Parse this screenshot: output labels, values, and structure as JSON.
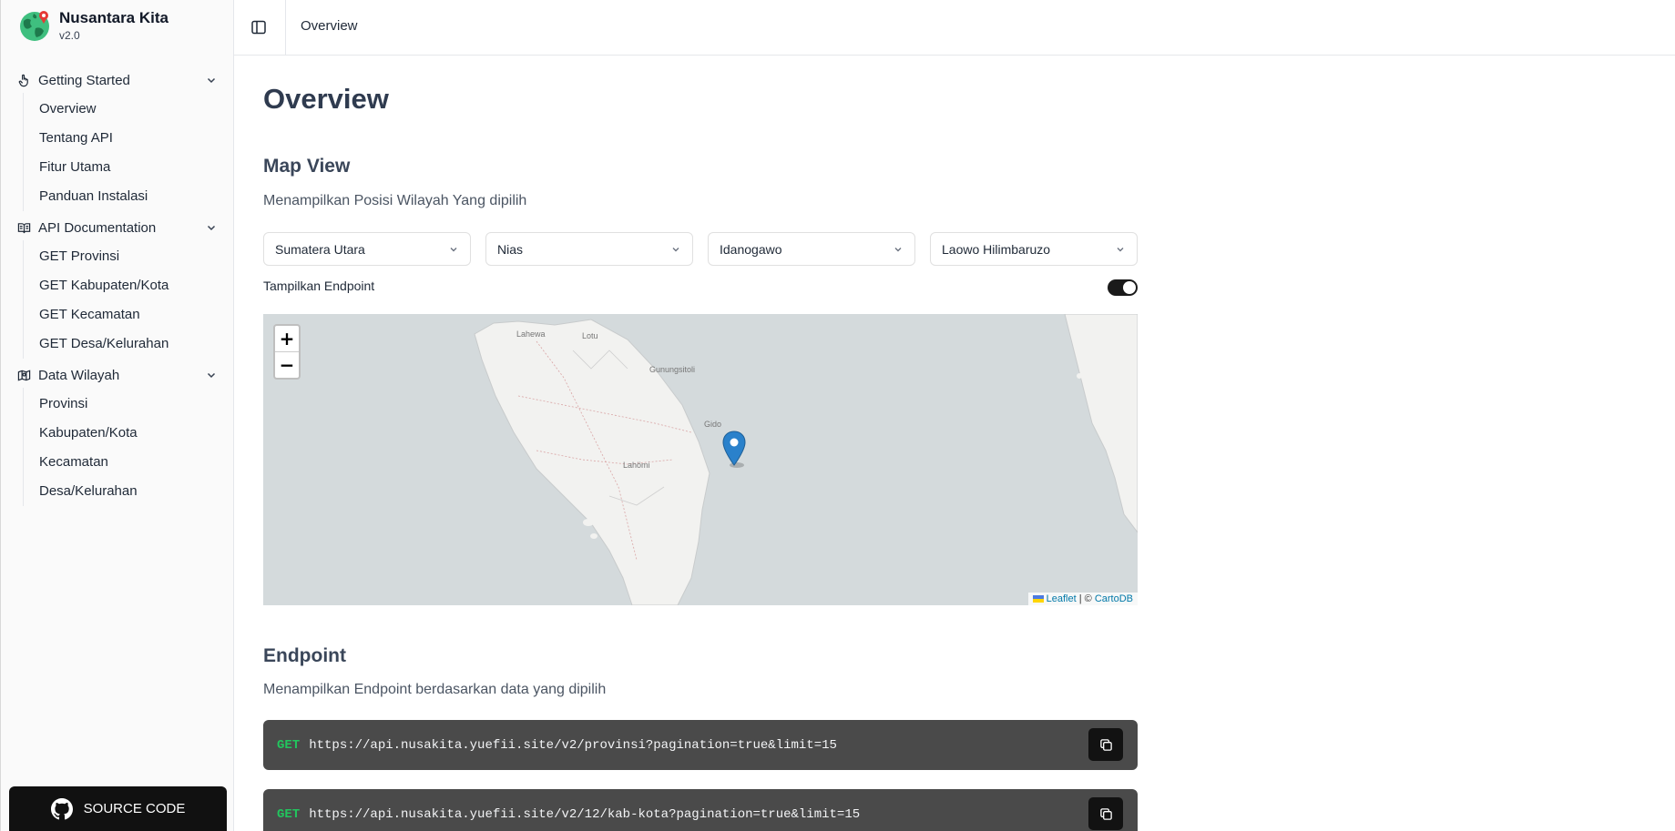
{
  "app": {
    "name": "Nusantara Kita",
    "version": "v2.0"
  },
  "sidebar": {
    "groups": [
      {
        "label": "Getting Started",
        "icon": "hand-pointer-icon",
        "items": [
          {
            "label": "Overview"
          },
          {
            "label": "Tentang API"
          },
          {
            "label": "Fitur Utama"
          },
          {
            "label": "Panduan Instalasi"
          }
        ]
      },
      {
        "label": "API Documentation",
        "icon": "book-icon",
        "items": [
          {
            "label": "GET Provinsi"
          },
          {
            "label": "GET Kabupaten/Kota"
          },
          {
            "label": "GET Kecamatan"
          },
          {
            "label": "GET Desa/Kelurahan"
          }
        ]
      },
      {
        "label": "Data Wilayah",
        "icon": "map-icon",
        "items": [
          {
            "label": "Provinsi"
          },
          {
            "label": "Kabupaten/Kota"
          },
          {
            "label": "Kecamatan"
          },
          {
            "label": "Desa/Kelurahan"
          }
        ]
      }
    ],
    "source_code_label": "SOURCE CODE"
  },
  "header": {
    "breadcrumb": "Overview"
  },
  "main": {
    "title": "Overview",
    "map_section": {
      "title": "Map View",
      "description": "Menampilkan Posisi Wilayah Yang dipilih",
      "selects": [
        {
          "value": "Sumatera Utara"
        },
        {
          "value": "Nias"
        },
        {
          "value": "Idanogawo"
        },
        {
          "value": "Laowo Hilimbaruzo"
        }
      ],
      "toggle_label": "Tampilkan Endpoint",
      "toggle_on": true,
      "zoom_in": "+",
      "zoom_out": "−",
      "map_labels": {
        "lahewa": "Lahewa",
        "lotu": "Lotu",
        "gunungsitoli": "Gunungsitoli",
        "gido": "Gido",
        "lahomi": "Lahömi"
      },
      "attribution": {
        "leaflet": "Leaflet",
        "separator": " | © ",
        "provider": "CartoDB"
      }
    },
    "endpoint_section": {
      "title": "Endpoint",
      "description": "Menampilkan Endpoint berdasarkan data yang dipilih",
      "endpoints": [
        {
          "method": "GET",
          "url": "https://api.nusakita.yuefii.site/v2/provinsi?pagination=true&limit=15"
        },
        {
          "method": "GET",
          "url": "https://api.nusakita.yuefii.site/v2/12/kab-kota?pagination=true&limit=15"
        }
      ]
    }
  },
  "colors": {
    "accent": "#111111",
    "method_green": "#22c55e",
    "code_bg": "#4a4a4a",
    "map_sea": "#d4dadc",
    "marker": "#2a81cb"
  }
}
